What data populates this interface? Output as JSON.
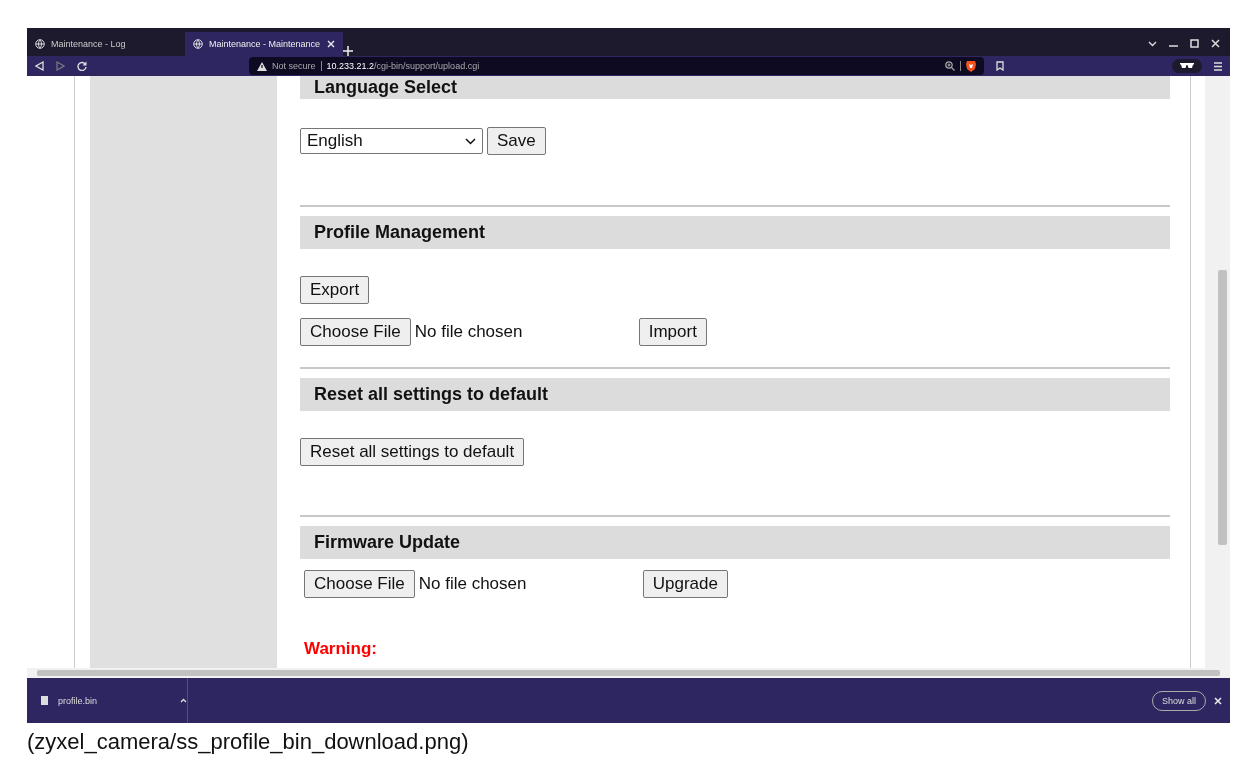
{
  "browser": {
    "tabs": [
      {
        "title": "Maintenance - Log",
        "selected": false
      },
      {
        "title": "Maintenance - Maintenance",
        "selected": true
      }
    ],
    "address": {
      "security": "Not secure",
      "host": "10.233.21.2",
      "path": "/cgi-bin/support/upload.cgi"
    }
  },
  "page": {
    "language": {
      "title": "Language Select",
      "select_value": "English",
      "button": "Save"
    },
    "profile": {
      "title": "Profile Management",
      "export_button": "Export",
      "file_button": "Choose File",
      "file_status": "No file chosen",
      "import_button": "Import"
    },
    "reset": {
      "title": "Reset all settings to default",
      "button": "Reset all settings to default"
    },
    "firmware": {
      "title": "Firmware Update",
      "file_button": "Choose File",
      "file_status": "No file chosen",
      "upgrade_button": "Upgrade",
      "warning": "Warning:"
    }
  },
  "download_bar": {
    "items": [
      {
        "filename": "profile.bin"
      }
    ],
    "show_all": "Show all"
  },
  "caption": "(zyxel_camera/ss_profile_bin_download.png)"
}
